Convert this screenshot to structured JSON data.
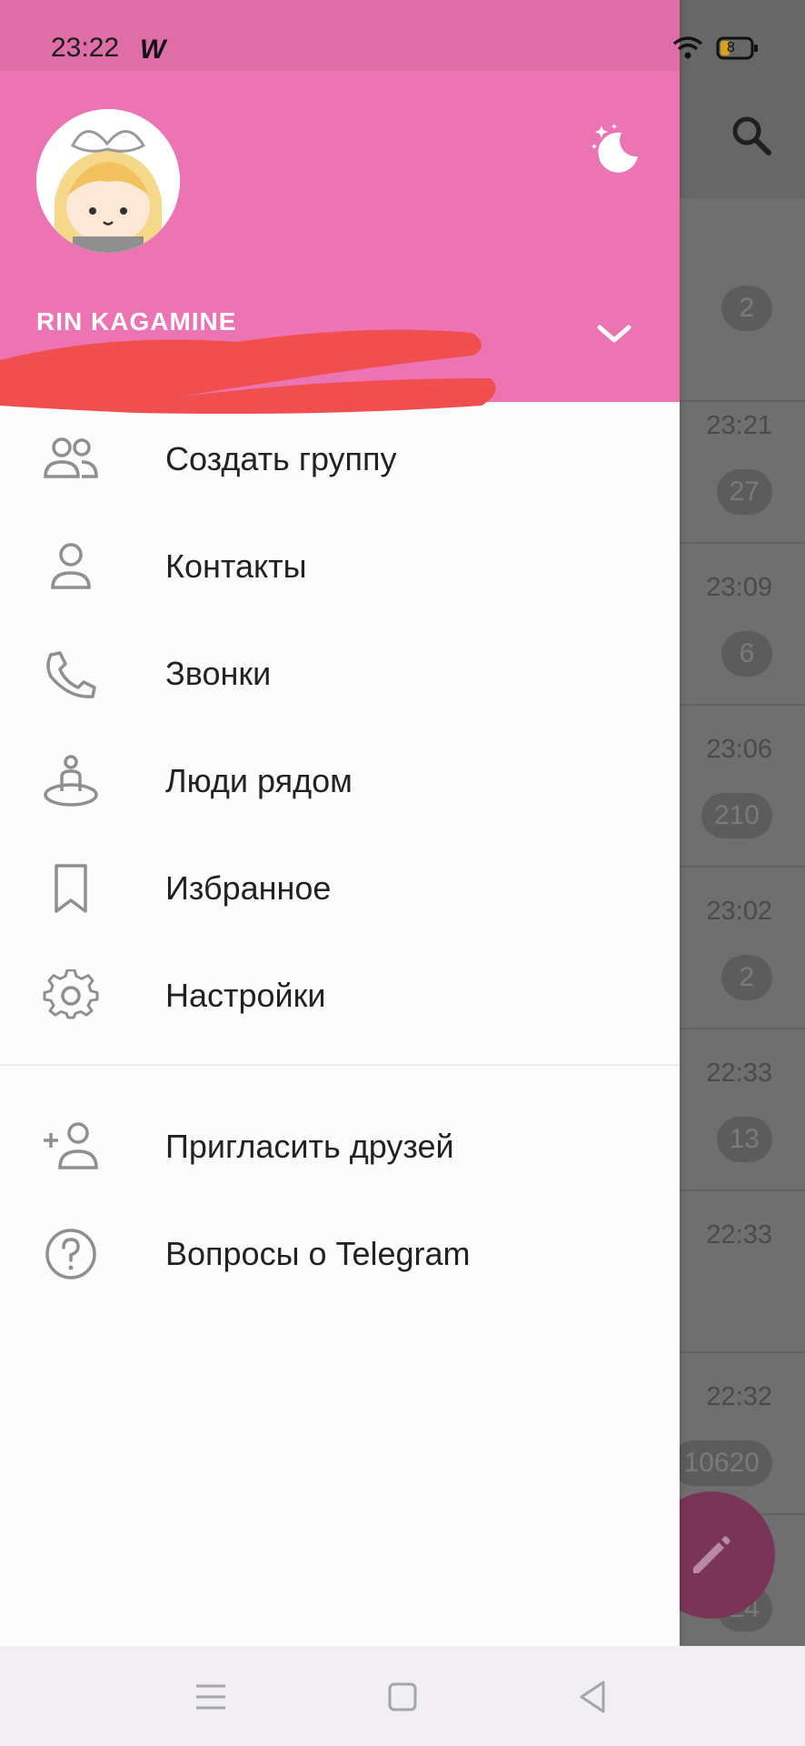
{
  "status_bar": {
    "time": "23:22",
    "app_glyph": "W",
    "battery_level": "8"
  },
  "drawer": {
    "user_name": "RIN KAGAMINE",
    "menu_primary": [
      {
        "label": "Создать группу",
        "icon": "group-icon"
      },
      {
        "label": "Контакты",
        "icon": "contact-icon"
      },
      {
        "label": "Звонки",
        "icon": "phone-icon"
      },
      {
        "label": "Люди рядом",
        "icon": "people-nearby-icon"
      },
      {
        "label": "Избранное",
        "icon": "bookmark-icon"
      },
      {
        "label": "Настройки",
        "icon": "gear-icon"
      }
    ],
    "menu_secondary": [
      {
        "label": "Пригласить друзей",
        "icon": "invite-user-icon"
      },
      {
        "label": "Вопросы о Telegram",
        "icon": "help-icon"
      }
    ]
  },
  "chat_list_bg": {
    "rows": [
      {
        "time": "",
        "badge": "2"
      },
      {
        "time": "23:21",
        "badge": "27"
      },
      {
        "time": "23:09",
        "badge": "6"
      },
      {
        "time": "23:06",
        "badge": "210"
      },
      {
        "time": "23:02",
        "badge": "2"
      },
      {
        "time": "22:33",
        "badge": "13"
      },
      {
        "time": "22:33",
        "badge": ""
      },
      {
        "time": "22:32",
        "badge": "10620"
      },
      {
        "time": "",
        "badge": "24"
      }
    ]
  },
  "colors": {
    "header": "#ec74b2",
    "status": "#df6ea8",
    "fab": "#7a3458"
  }
}
